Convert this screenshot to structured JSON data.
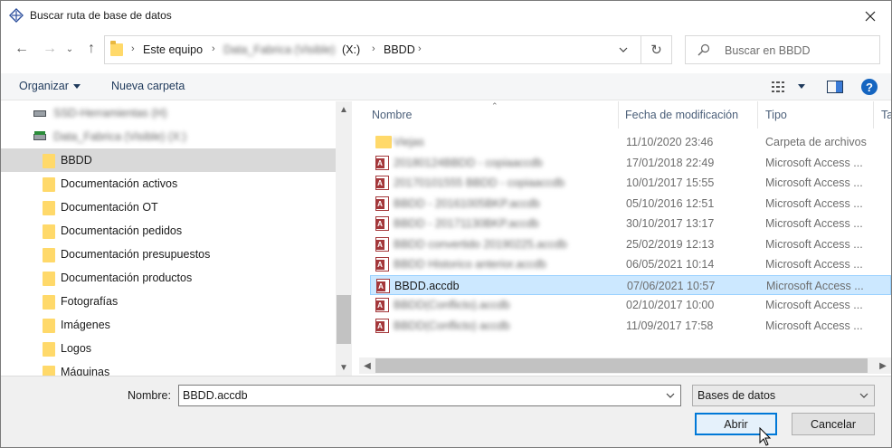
{
  "window": {
    "title": "Buscar ruta de base de datos"
  },
  "address": {
    "crumbs": [
      "Este equipo",
      "Data_Fabrica (Visible)",
      "(X:)",
      "BBDD"
    ]
  },
  "search": {
    "placeholder": "Buscar en BBDD"
  },
  "toolbar": {
    "organize": "Organizar",
    "new_folder": "Nueva carpeta"
  },
  "nav": {
    "drives": [
      {
        "label": "SSD-Herramientas (H)"
      },
      {
        "label": "Data_Fabrica (Visible) (X:)"
      }
    ],
    "folders": [
      {
        "label": "BBDD",
        "selected": true
      },
      {
        "label": "Documentación activos"
      },
      {
        "label": "Documentación OT"
      },
      {
        "label": "Documentación pedidos"
      },
      {
        "label": "Documentación presupuestos"
      },
      {
        "label": "Documentación productos"
      },
      {
        "label": "Fotografías"
      },
      {
        "label": "Imágenes"
      },
      {
        "label": "Logos"
      },
      {
        "label": "Máquinas"
      }
    ]
  },
  "columns": {
    "name": "Nombre",
    "date": "Fecha de modificación",
    "type": "Tipo",
    "size": "Ta"
  },
  "files": [
    {
      "name": "Viejas",
      "date": "11/10/2020 23:46",
      "type": "Carpeta de archivos",
      "icon": "folder-icon",
      "obscured": true
    },
    {
      "name": "20180124BBDD - copiaaccdb",
      "date": "17/01/2018 22:49",
      "type": "Microsoft Access ...",
      "icon": "access-file-icon",
      "obscured": true
    },
    {
      "name": "20170101555 BBDD - copiaaccdb",
      "date": "10/01/2017 15:55",
      "type": "Microsoft Access ...",
      "icon": "access-file-icon",
      "obscured": true
    },
    {
      "name": "BBDD - 20161005BKP.accdb",
      "date": "05/10/2016 12:51",
      "type": "Microsoft Access ...",
      "icon": "access-file-icon",
      "obscured": true
    },
    {
      "name": "BBDD - 20171130BKP.accdb",
      "date": "30/10/2017 13:17",
      "type": "Microsoft Access ...",
      "icon": "access-file-icon",
      "obscured": true
    },
    {
      "name": "BBDD convertido 20190225.accdb",
      "date": "25/02/2019 12:13",
      "type": "Microsoft Access ...",
      "icon": "access-file-icon",
      "obscured": true
    },
    {
      "name": "BBDD Historico anterior.accdb",
      "date": "06/05/2021 10:14",
      "type": "Microsoft Access ...",
      "icon": "access-file-icon",
      "obscured": true
    },
    {
      "name": "BBDD.accdb",
      "date": "07/06/2021 10:57",
      "type": "Microsoft Access ...",
      "icon": "access-file-icon",
      "obscured": false,
      "selected": true
    },
    {
      "name": "BBDD(Conflicto).accdb",
      "date": "02/10/2017 10:00",
      "type": "Microsoft Access ...",
      "icon": "access-file-icon",
      "obscured": true
    },
    {
      "name": "BBDD(Conflicto) accdb",
      "date": "11/09/2017 17:58",
      "type": "Microsoft Access ...",
      "icon": "access-file-icon",
      "obscured": true
    }
  ],
  "footer": {
    "filename_label": "Nombre:",
    "filename_value": "BBDD.accdb",
    "filter_value": "Bases de datos",
    "open_label": "Abrir",
    "cancel_label": "Cancelar"
  },
  "colors": {
    "accent": "#0078d7",
    "selected_row": "#cce8ff",
    "folder": "#ffd96a",
    "access": "#a4373a"
  }
}
